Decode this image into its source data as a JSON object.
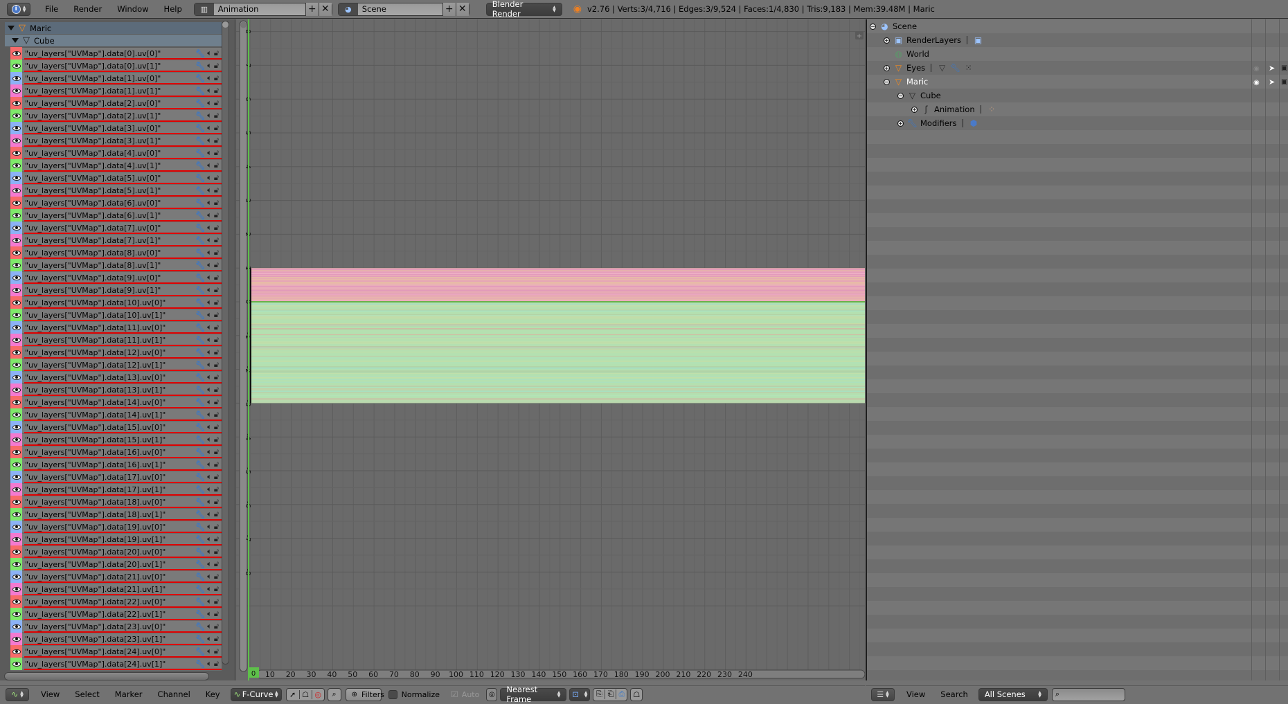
{
  "topbar": {
    "menus": [
      "File",
      "Render",
      "Window",
      "Help"
    ],
    "screen_layout": "Animation",
    "scene": "Scene",
    "render_engine": "Blender Render",
    "stats": "v2.76 | Verts:3/4,716 | Edges:3/9,524 | Faces:1/4,830 | Tris:9,183 | Mem:39.48M | Maric"
  },
  "channels": {
    "object": "Maric",
    "datablock": "Cube",
    "swatch_cycle": [
      "#f86a6a",
      "#7ee86a",
      "#8cb2f6",
      "#f47ad0"
    ],
    "items": [
      "\"uv_layers[\"UVMap\"].data[0].uv[0]\"",
      "\"uv_layers[\"UVMap\"].data[0].uv[1]\"",
      "\"uv_layers[\"UVMap\"].data[1].uv[0]\"",
      "\"uv_layers[\"UVMap\"].data[1].uv[1]\"",
      "\"uv_layers[\"UVMap\"].data[2].uv[0]\"",
      "\"uv_layers[\"UVMap\"].data[2].uv[1]\"",
      "\"uv_layers[\"UVMap\"].data[3].uv[0]\"",
      "\"uv_layers[\"UVMap\"].data[3].uv[1]\"",
      "\"uv_layers[\"UVMap\"].data[4].uv[0]\"",
      "\"uv_layers[\"UVMap\"].data[4].uv[1]\"",
      "\"uv_layers[\"UVMap\"].data[5].uv[0]\"",
      "\"uv_layers[\"UVMap\"].data[5].uv[1]\"",
      "\"uv_layers[\"UVMap\"].data[6].uv[0]\"",
      "\"uv_layers[\"UVMap\"].data[6].uv[1]\"",
      "\"uv_layers[\"UVMap\"].data[7].uv[0]\"",
      "\"uv_layers[\"UVMap\"].data[7].uv[1]\"",
      "\"uv_layers[\"UVMap\"].data[8].uv[0]\"",
      "\"uv_layers[\"UVMap\"].data[8].uv[1]\"",
      "\"uv_layers[\"UVMap\"].data[9].uv[0]\"",
      "\"uv_layers[\"UVMap\"].data[9].uv[1]\"",
      "\"uv_layers[\"UVMap\"].data[10].uv[0]\"",
      "\"uv_layers[\"UVMap\"].data[10].uv[1]\"",
      "\"uv_layers[\"UVMap\"].data[11].uv[0]\"",
      "\"uv_layers[\"UVMap\"].data[11].uv[1]\"",
      "\"uv_layers[\"UVMap\"].data[12].uv[0]\"",
      "\"uv_layers[\"UVMap\"].data[12].uv[1]\"",
      "\"uv_layers[\"UVMap\"].data[13].uv[0]\"",
      "\"uv_layers[\"UVMap\"].data[13].uv[1]\"",
      "\"uv_layers[\"UVMap\"].data[14].uv[0]\"",
      "\"uv_layers[\"UVMap\"].data[14].uv[1]\"",
      "\"uv_layers[\"UVMap\"].data[15].uv[0]\"",
      "\"uv_layers[\"UVMap\"].data[15].uv[1]\"",
      "\"uv_layers[\"UVMap\"].data[16].uv[0]\"",
      "\"uv_layers[\"UVMap\"].data[16].uv[1]\"",
      "\"uv_layers[\"UVMap\"].data[17].uv[0]\"",
      "\"uv_layers[\"UVMap\"].data[17].uv[1]\"",
      "\"uv_layers[\"UVMap\"].data[18].uv[0]\"",
      "\"uv_layers[\"UVMap\"].data[18].uv[1]\"",
      "\"uv_layers[\"UVMap\"].data[19].uv[0]\"",
      "\"uv_layers[\"UVMap\"].data[19].uv[1]\"",
      "\"uv_layers[\"UVMap\"].data[20].uv[0]\"",
      "\"uv_layers[\"UVMap\"].data[20].uv[1]\"",
      "\"uv_layers[\"UVMap\"].data[21].uv[0]\"",
      "\"uv_layers[\"UVMap\"].data[21].uv[1]\"",
      "\"uv_layers[\"UVMap\"].data[22].uv[0]\"",
      "\"uv_layers[\"UVMap\"].data[22].uv[1]\"",
      "\"uv_layers[\"UVMap\"].data[23].uv[0]\"",
      "\"uv_layers[\"UVMap\"].data[23].uv[1]\"",
      "\"uv_layers[\"UVMap\"].data[24].uv[0]\"",
      "\"uv_layers[\"UVMap\"].data[24].uv[1]\""
    ]
  },
  "graph": {
    "current_frame": "0",
    "y_ticks": [
      "9",
      "8",
      "7",
      "6",
      "5",
      "4",
      "3",
      "2",
      "1",
      "0",
      "-1",
      "-2",
      "-3",
      "-4",
      "-5",
      "-6",
      "-7",
      "-8"
    ],
    "x_ticks": [
      "10",
      "20",
      "30",
      "40",
      "50",
      "60",
      "70",
      "80",
      "90",
      "100",
      "110",
      "120",
      "130",
      "140",
      "150",
      "160",
      "170",
      "180",
      "190",
      "200",
      "210",
      "220",
      "230",
      "240"
    ],
    "positive_band": [
      0,
      1
    ],
    "negative_band": [
      -3,
      0
    ],
    "positive_color": "#e7aab4",
    "negative_color": "#b4e0b0",
    "frame_line_color": "#5ec04a"
  },
  "graph_header": {
    "menus": [
      "View",
      "Select",
      "Marker",
      "Channel",
      "Key"
    ],
    "mode": "F-Curve",
    "filters": "Filters",
    "normalize": "Normalize",
    "auto": "Auto",
    "snap": "Nearest Frame"
  },
  "outliner": {
    "rows": [
      {
        "label": "Scene",
        "level": 0,
        "expander": "minus",
        "icon": "scene"
      },
      {
        "label": "RenderLayers",
        "level": 1,
        "expander": "plus",
        "icon": "renderlayers"
      },
      {
        "label": "World",
        "level": 1,
        "expander": "",
        "icon": "world"
      },
      {
        "label": "Eyes",
        "level": 1,
        "expander": "plus",
        "icon": "mesh-object"
      },
      {
        "label": "Maric",
        "level": 1,
        "expander": "minus",
        "icon": "mesh-object"
      },
      {
        "label": "Cube",
        "level": 2,
        "expander": "minus",
        "icon": "mesh-data"
      },
      {
        "label": "Animation",
        "level": 3,
        "expander": "plus",
        "icon": "animation"
      },
      {
        "label": "Modifiers",
        "level": 2,
        "expander": "plus",
        "icon": "wrench"
      }
    ]
  },
  "outliner_header": {
    "menus": [
      "View",
      "Search"
    ],
    "display_mode": "All Scenes",
    "search_placeholder": ""
  }
}
